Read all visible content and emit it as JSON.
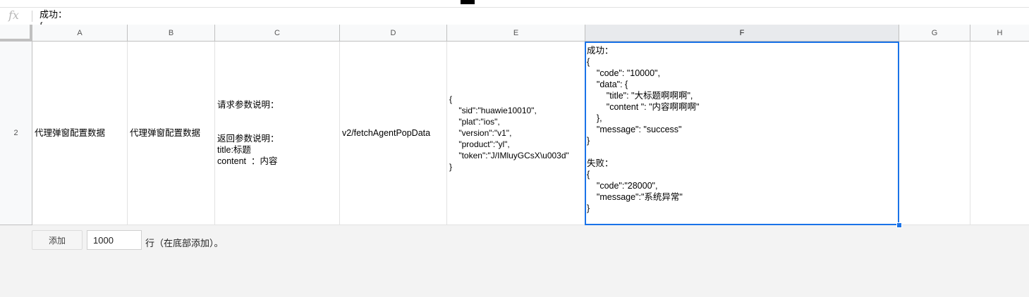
{
  "formula_bar": {
    "icon": "fx-icon",
    "text": "成功：\n{"
  },
  "columns": [
    "A",
    "B",
    "C",
    "D",
    "E",
    "F",
    "G",
    "H"
  ],
  "selected_column": "F",
  "row": {
    "header": "2",
    "cells": {
      "A": "代理弹窗配置数据",
      "B": "代理弹窗配置数据",
      "C": "请求参数说明：\n\n\n返回参数说明：\ntitle:标题\ncontent  ：内容",
      "D": "v2/fetchAgentPopData",
      "E": "{\n    \"sid\":\"huawie10010\",\n    \"plat\":\"ios\",\n    \"version\":\"v1\",\n    \"product\":\"yl\",\n    \"token\":\"J/IMluyGCsX\\u003d\"\n}",
      "F": "成功：\n{\n    \"code\": \"10000\",\n    \"data\": {\n        \"title\": \"大标题啊啊啊\",\n        \"content \": \"内容啊啊啊\"\n    },\n    \"message\": \"success\"\n}\n\n失败：\n{\n    \"code\":\"28000\",\n    \"message\":\"系统异常\"\n}",
      "G": "",
      "H": ""
    }
  },
  "bottom_bar": {
    "add_button": "添加",
    "rows_value": "1000",
    "suffix": "行（在底部添加）。"
  },
  "colors": {
    "selection": "#1a73e8",
    "header_bg": "#f8f9fa",
    "gridline": "#e2e2e2"
  }
}
